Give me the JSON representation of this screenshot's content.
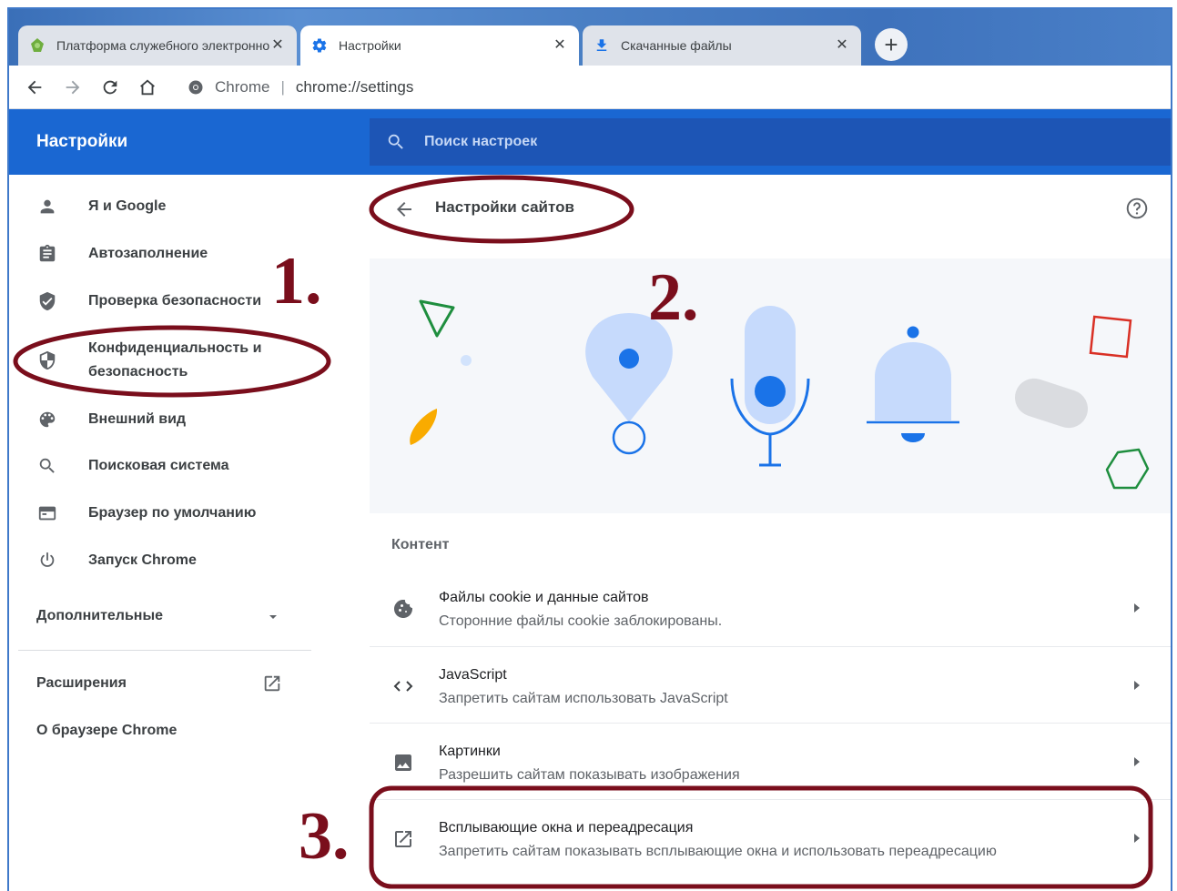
{
  "browser": {
    "tabs": [
      {
        "title": "Платформа служебного электронного",
        "active": false,
        "icon": "leaf-favicon"
      },
      {
        "title": "Настройки",
        "active": true,
        "icon": "gear-icon"
      },
      {
        "title": "Скачанные файлы",
        "active": false,
        "icon": "download-icon"
      }
    ],
    "tab_close": "✕",
    "new_tab": "+",
    "omnibox": {
      "site": "Chrome",
      "separator": "|",
      "url": "chrome://settings"
    }
  },
  "header": {
    "title": "Настройки",
    "search_placeholder": "Поиск настроек"
  },
  "sidebar": {
    "items": [
      {
        "label": "Я и Google",
        "icon": "person-icon"
      },
      {
        "label": "Автозаполнение",
        "icon": "clipboard-icon"
      },
      {
        "label": "Проверка безопасности",
        "icon": "shield-check-icon"
      },
      {
        "label_line1": "Конфиденциальность и",
        "label_line2": "безопасность",
        "icon": "shield-icon"
      },
      {
        "label": "Внешний вид",
        "icon": "palette-icon"
      },
      {
        "label": "Поисковая система",
        "icon": "search-icon"
      },
      {
        "label": "Браузер по умолчанию",
        "icon": "browser-window-icon"
      },
      {
        "label": "Запуск Chrome",
        "icon": "power-icon"
      }
    ],
    "advanced": "Дополнительные",
    "extensions": "Расширения",
    "about": "О браузере Chrome"
  },
  "main": {
    "title": "Настройки сайтов",
    "section": "Контент",
    "rows": [
      {
        "title": "Файлы cookie и данные сайтов",
        "subtitle": "Сторонние файлы cookie заблокированы.",
        "icon": "cookie-icon"
      },
      {
        "title": "JavaScript",
        "subtitle": "Запретить сайтам использовать JavaScript",
        "icon": "code-icon"
      },
      {
        "title": "Картинки",
        "subtitle": "Разрешить сайтам показывать изображения",
        "icon": "image-icon"
      },
      {
        "title": "Всплывающие окна и переадресация",
        "subtitle": "Запретить сайтам показывать всплывающие окна и использовать переадресацию",
        "icon": "open-in-new-icon"
      }
    ]
  },
  "annotations": {
    "step1": "1.",
    "step2": "2.",
    "step3": "3.",
    "color": "#7a0e1c"
  },
  "colors": {
    "accent": "#1a67d2",
    "search_bg": "#1d55b5",
    "illustration_blue": "#1a73e8",
    "illustration_light_blue": "#c6dafc",
    "triangle_green": "#1e8e3e",
    "square_red": "#d93025",
    "moon_yellow": "#f9ab00"
  }
}
